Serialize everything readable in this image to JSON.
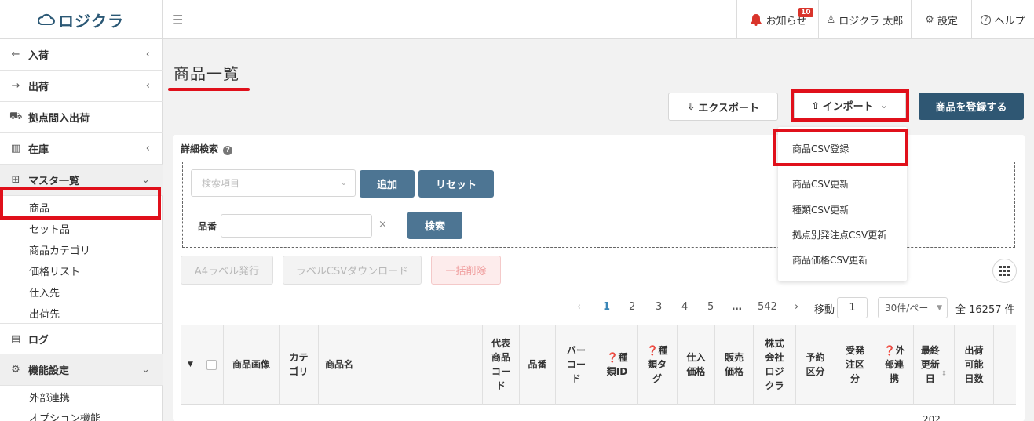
{
  "header": {
    "logo": "ロジクラ",
    "notice_label": "お知らせ",
    "notice_count": "10",
    "user_name": "ロジクラ 太郎",
    "settings_label": "設定",
    "help_label": "ヘルプ"
  },
  "sidebar": {
    "items": [
      {
        "label": "入荷",
        "icon": "arrow-left-icon"
      },
      {
        "label": "出荷",
        "icon": "arrow-right-icon"
      },
      {
        "label": "拠点間入出荷",
        "icon": "truck-icon"
      },
      {
        "label": "在庫",
        "icon": "warehouse-icon"
      },
      {
        "label": "マスタ一覧",
        "icon": "grid-icon"
      },
      {
        "label": "ログ",
        "icon": "log-icon"
      },
      {
        "label": "機能設定",
        "icon": "gear-icon"
      }
    ],
    "master_sub": [
      "商品",
      "セット品",
      "商品カテゴリ",
      "価格リスト",
      "仕入先",
      "出荷先"
    ],
    "settings_sub": [
      "外部連携",
      "オプション機能"
    ]
  },
  "main": {
    "title": "商品一覧",
    "export_label": "エクスポート",
    "import_label": "インポート",
    "register_label": "商品を登録する",
    "import_menu": [
      "商品CSV登録",
      "商品CSV更新",
      "種類CSV更新",
      "拠点別発注点CSV更新",
      "商品価格CSV更新"
    ],
    "search": {
      "title": "詳細検索",
      "select_placeholder": "検索項目",
      "add_label": "追加",
      "reset_label": "リセット",
      "hinban_label": "品番",
      "clear_label": "×",
      "search_label": "検索"
    },
    "actions": {
      "a4_label": "A4ラベル発行",
      "csv_label": "ラベルCSVダウンロード",
      "delete_label": "一括削除"
    },
    "pagination": {
      "pages": [
        "1",
        "2",
        "3",
        "4",
        "5",
        "…",
        "542"
      ],
      "prev": "‹",
      "next": "›",
      "goto_label": "移動",
      "goto_value": "1",
      "per_page": "30件/ペー",
      "total": "全 16257 件"
    },
    "table": {
      "columns": [
        "商品画像",
        "カテ\nゴリ",
        "商品名",
        "代表\n商品\nコー\nド",
        "品番",
        "バー\nコー\nド",
        "❓種\n類ID",
        "❓種\n類タ\nグ",
        "仕入\n価格",
        "販売\n価格",
        "株式\n会社\nロジ\nクラ",
        "予約\n区分",
        "受発\n注区\n分",
        "❓外\n部連\n携",
        "最終\n更新\n日",
        "出荷\n可能\n日数"
      ],
      "partial_row": "202"
    }
  }
}
